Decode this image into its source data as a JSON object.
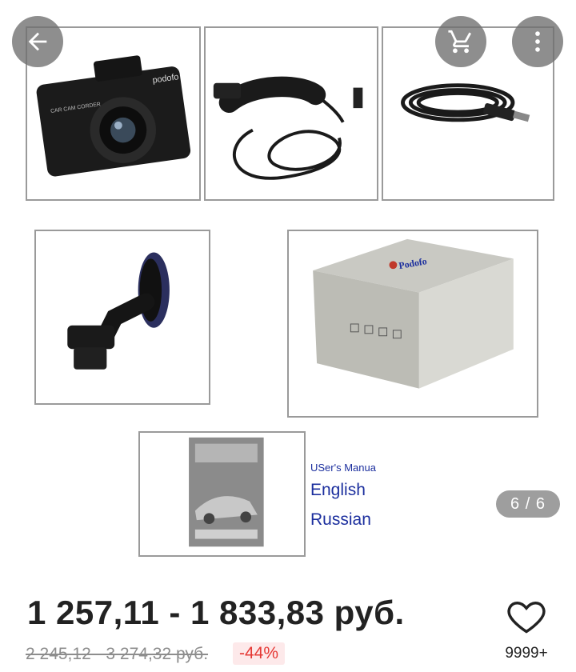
{
  "nav": {
    "back_icon": "arrow-left-icon",
    "cart_icon": "cart-icon",
    "more_icon": "more-vert-icon"
  },
  "gallery": {
    "camera_brand": "podofo",
    "camera_label": "CAR CAM CORDER",
    "box_brand": "Podofo",
    "manual_heading": "USer's Manua",
    "manual_lang_1": "English",
    "manual_lang_2": "Russian",
    "counter": "6 / 6"
  },
  "product": {
    "price": "1 257,11 - 1 833,83 руб.",
    "old_price": "2 245,12 - 3 274,32 руб.",
    "discount": "-44%",
    "wishlist_icon": "heart-outline-icon",
    "wishlist_count": "9999+"
  },
  "colors": {
    "discount_text": "#e53935",
    "discount_bg": "#fde9ea",
    "manual_text": "#1c2f9e",
    "overlay_button": "#6e6e6e"
  }
}
